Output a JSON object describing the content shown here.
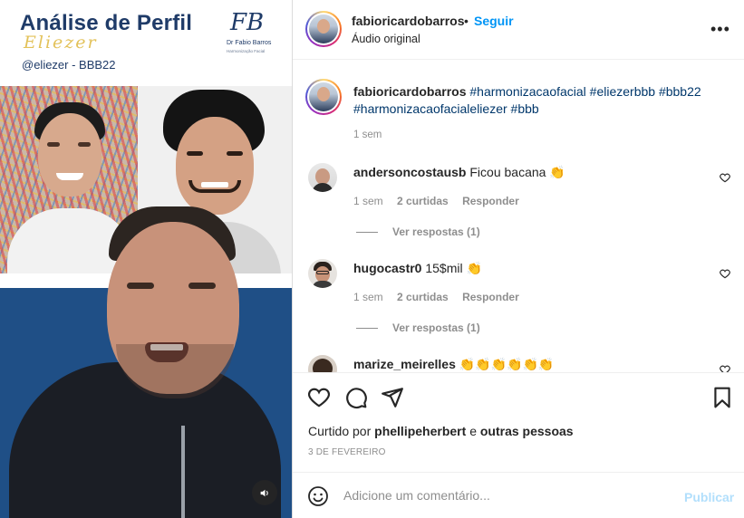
{
  "media": {
    "banner_title": "Análise de Perfil",
    "banner_script": "Eliezer",
    "banner_handle": "@eliezer - BBB22",
    "logo_mark": "FB",
    "logo_name": "Dr Fabio Barros",
    "logo_sub": "Harmonização Facial",
    "sound_icon": "speaker-icon"
  },
  "post": {
    "author": "fabioricardobarros",
    "dot": "•",
    "follow_label": "Seguir",
    "audio_label": "Áudio original",
    "more_label": "•••",
    "caption_user": "fabioricardobarros",
    "caption_tags": "#harmonizacaofacial #eliezerbbb #bbb22 #harmonizacaofacialeliezer #bbb",
    "caption_time": "1 sem"
  },
  "comments": [
    {
      "user": "andersoncostausb",
      "text": "Ficou bacana 👏",
      "time": "1 sem",
      "likes": "2 curtidas",
      "reply": "Responder",
      "view_replies": "Ver respostas (1)"
    },
    {
      "user": "hugocastr0",
      "text": "15$mil 👏",
      "time": "1 sem",
      "likes": "2 curtidas",
      "reply": "Responder",
      "view_replies": "Ver respostas (1)"
    },
    {
      "user": "marize_meirelles",
      "text": "👏👏👏👏👏👏"
    }
  ],
  "footer": {
    "liked_prefix": "Curtido por",
    "liked_user": "phellipeherbert",
    "liked_conj": "e",
    "liked_others": "outras pessoas",
    "date": "3 DE FEVEREIRO",
    "comment_placeholder": "Adicione um comentário...",
    "publish_label": "Publicar"
  },
  "colors": {
    "accent": "#0095f6",
    "publish_disabled": "#b2dffc",
    "hashtag": "#00376b",
    "banner_blue": "#1f3b68",
    "gold": "#e3c25a"
  }
}
